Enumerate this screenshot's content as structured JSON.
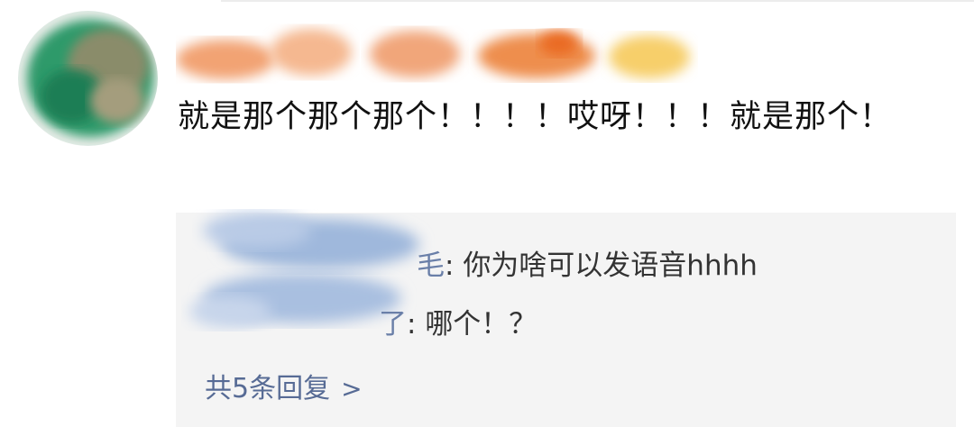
{
  "comment": {
    "text": "就是那个那个那个！！！！哎呀！！！就是那个！"
  },
  "replies": [
    {
      "name_visible_tail": "毛",
      "separator": ": ",
      "text": "你为啥可以发语音hhhh"
    },
    {
      "name_visible_tail": "了",
      "separator": ": ",
      "text": "哪个！？"
    }
  ],
  "more_replies": {
    "label": "共5条回复",
    "chevron": ">"
  },
  "colors": {
    "reply_background": "#f4f4f4",
    "link": "#576b95",
    "text": "#111111"
  }
}
